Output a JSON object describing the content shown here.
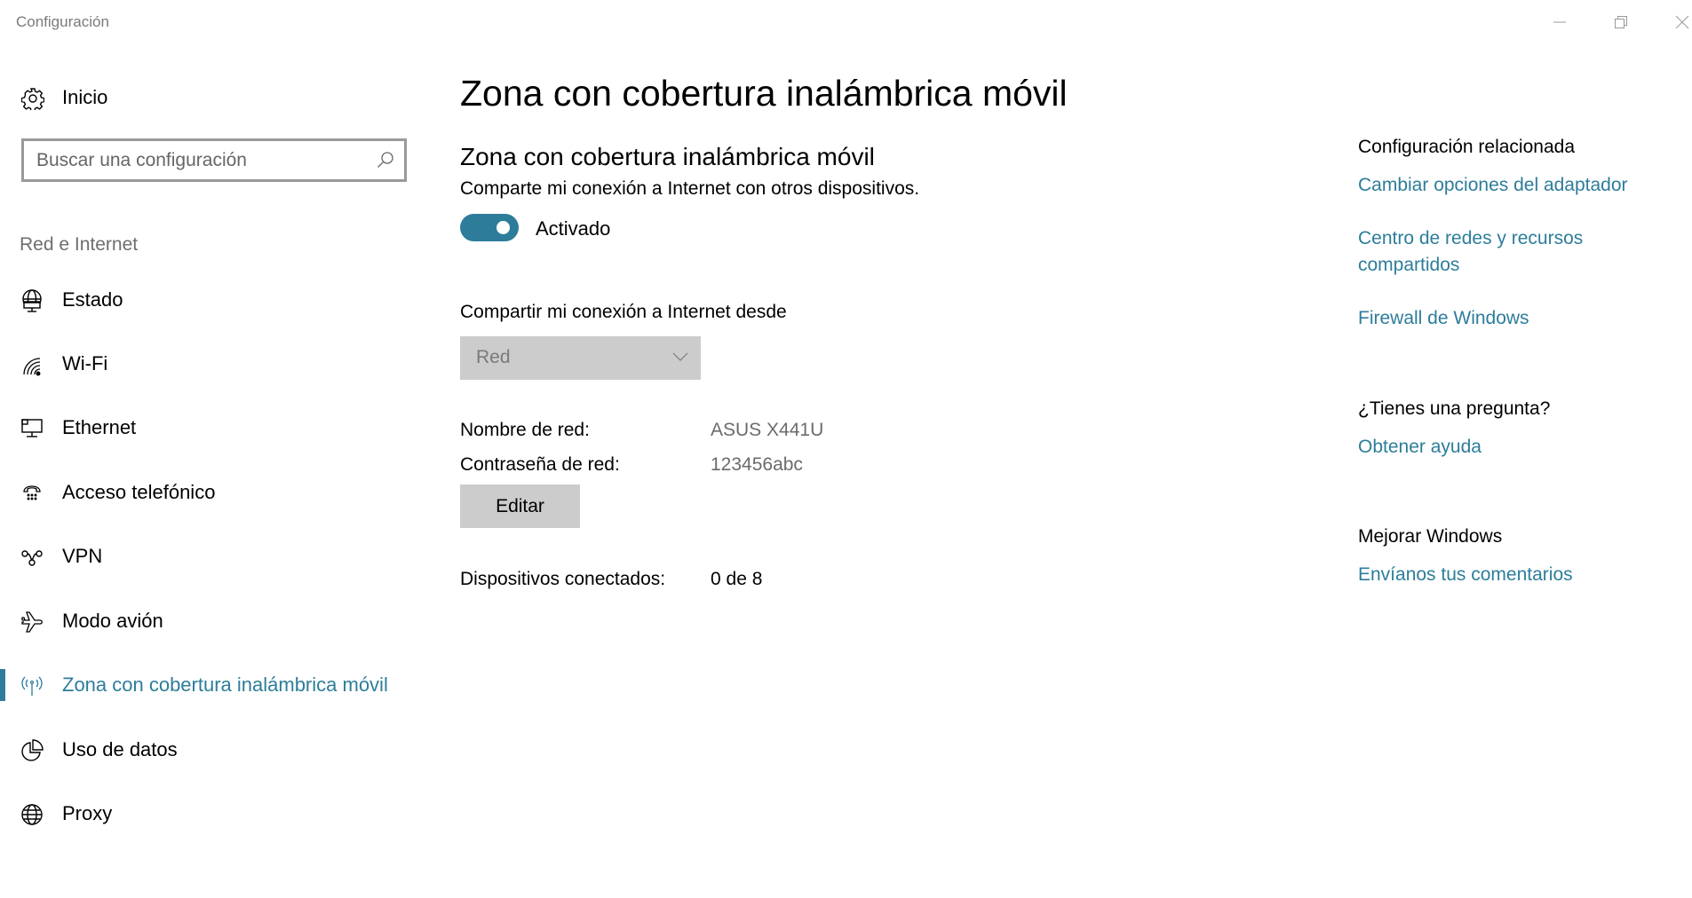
{
  "window": {
    "title": "Configuración",
    "controls": {
      "minimize": "minimize-icon",
      "restore": "restore-icon",
      "close": "close-icon"
    }
  },
  "sidebar": {
    "home": {
      "label": "Inicio",
      "icon": "gear-icon"
    },
    "search": {
      "placeholder": "Buscar una configuración",
      "value": "",
      "icon": "search-icon"
    },
    "section_label": "Red e Internet",
    "items": [
      {
        "label": "Estado",
        "icon": "network-status-icon",
        "active": false
      },
      {
        "label": "Wi-Fi",
        "icon": "wifi-icon",
        "active": false
      },
      {
        "label": "Ethernet",
        "icon": "ethernet-icon",
        "active": false
      },
      {
        "label": "Acceso telefónico",
        "icon": "dialup-phone-icon",
        "active": false
      },
      {
        "label": "VPN",
        "icon": "vpn-icon",
        "active": false
      },
      {
        "label": "Modo avión",
        "icon": "airplane-icon",
        "active": false
      },
      {
        "label": "Zona con cobertura inalámbrica móvil",
        "icon": "hotspot-icon",
        "active": true
      },
      {
        "label": "Uso de datos",
        "icon": "data-usage-icon",
        "active": false
      },
      {
        "label": "Proxy",
        "icon": "globe-icon",
        "active": false
      }
    ]
  },
  "main": {
    "title": "Zona con cobertura inalámbrica móvil",
    "section_title": "Zona con cobertura inalámbrica móvil",
    "description": "Comparte mi conexión a Internet con otros dispositivos.",
    "toggle": {
      "on": true,
      "label": "Activado"
    },
    "share_from": {
      "label": "Compartir mi conexión a Internet desde",
      "selected": "Red",
      "disabled": true
    },
    "network_name": {
      "label": "Nombre de red:",
      "value": "ASUS X441U"
    },
    "network_password": {
      "label": "Contraseña de red:",
      "value": "123456abc"
    },
    "edit_button": "Editar",
    "connected_devices": {
      "label": "Dispositivos conectados:",
      "value": "0 de 8"
    }
  },
  "related": {
    "heading": "Configuración relacionada",
    "links": [
      "Cambiar opciones del adaptador",
      "Centro de redes y recursos compartidos",
      "Firewall de Windows"
    ],
    "question_heading": "¿Tienes una pregunta?",
    "help_link": "Obtener ayuda",
    "improve_heading": "Mejorar Windows",
    "feedback_link": "Envíanos tus comentarios"
  },
  "colors": {
    "accent": "#2d7d9a",
    "disabled_bg": "#cccccc",
    "muted_text": "#6b6b6b"
  }
}
